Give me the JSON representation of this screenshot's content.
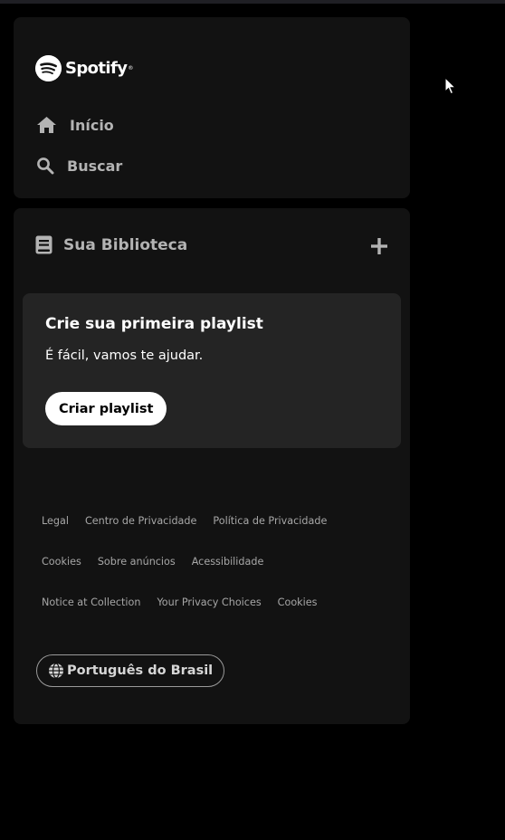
{
  "app": {
    "logo_text": "Spotify",
    "logo_mark": "®"
  },
  "nav": {
    "home": {
      "icon": "home-icon",
      "label": "Início"
    },
    "search": {
      "icon": "search-icon",
      "label": "Buscar"
    }
  },
  "library": {
    "icon": "library-icon",
    "title": "Sua Biblioteca",
    "add_icon": "plus-icon",
    "card": {
      "title": "Crie sua primeira playlist",
      "subtitle": "É fácil, vamos te ajudar.",
      "button_label": "Criar playlist"
    }
  },
  "footer": {
    "rows": [
      [
        "Legal",
        "Centro de Privacidade",
        "Política de Privacidade"
      ],
      [
        "Cookies",
        "Sobre anúncios",
        "Acessibilidade"
      ],
      [
        "Notice at Collection",
        "Your Privacy Choices",
        "Cookies"
      ]
    ]
  },
  "language": {
    "icon": "globe-icon",
    "label": "Português do Brasil"
  },
  "colors": {
    "background": "#000000",
    "panel": "#121212",
    "card": "#242424",
    "text_muted": "#b3b3b3",
    "footer_text": "#a7a7a7",
    "white": "#ffffff"
  }
}
